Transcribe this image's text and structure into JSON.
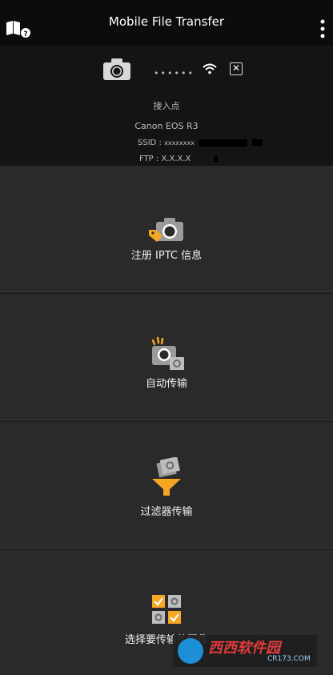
{
  "app": {
    "title": "Mobile File Transfer"
  },
  "status": {
    "dots": "••••••",
    "ap_label": "接入点",
    "camera_model": "Canon EOS R3",
    "ssid_label": "SSID :",
    "ssid_value": "xxxxxxxx",
    "ftp_label": "FTP :",
    "ftp_value": "X.X.X.X",
    "disconnect_symbol": "✕"
  },
  "menu": [
    {
      "label": "注册 IPTC 信息",
      "icon": "camera-tag-icon"
    },
    {
      "label": "自动传输",
      "icon": "auto-transfer-camera-icon"
    },
    {
      "label": "过滤器传输",
      "icon": "filter-funnel-icon"
    },
    {
      "label": "选择要传输的图像",
      "icon": "image-grid-check-icon"
    }
  ],
  "colors": {
    "accent": "#f5a623",
    "topbar_bg": "#0c0c0c",
    "item_bg": "#2a2a2a"
  },
  "watermark": {
    "name": "西西软件园",
    "url": "CR173.COM"
  }
}
